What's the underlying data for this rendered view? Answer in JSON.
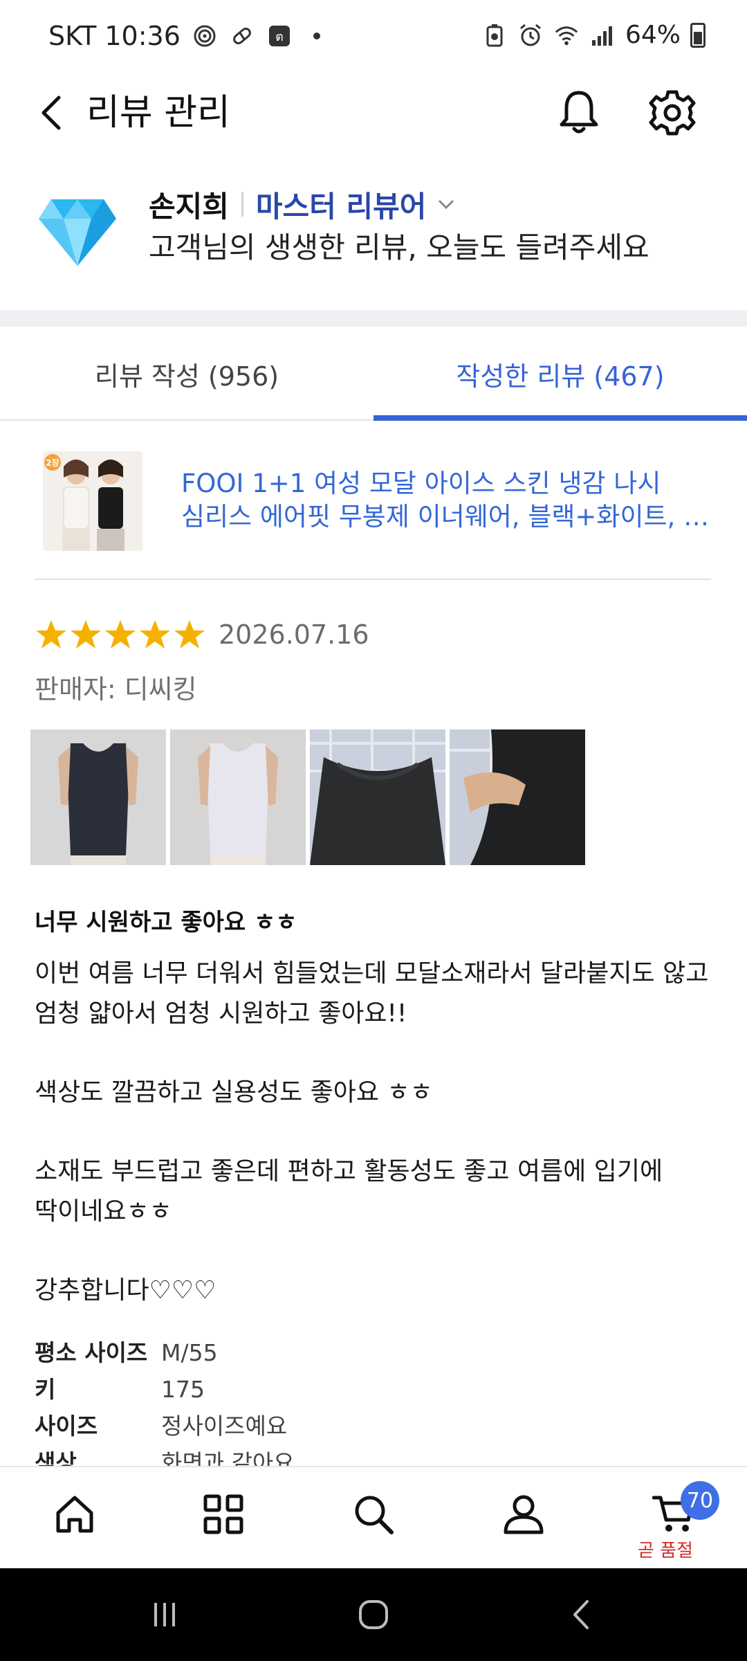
{
  "status_bar": {
    "carrier_time": "SKT 10:36",
    "battery": "64%"
  },
  "header": {
    "title": "리뷰 관리"
  },
  "profile": {
    "name": "손지희",
    "grade": "마스터 리뷰어",
    "subtitle": "고객님의 생생한 리뷰, 오늘도 들려주세요"
  },
  "tabs": [
    {
      "label": "리뷰 작성 (956)",
      "active": false
    },
    {
      "label": "작성한 리뷰 (467)",
      "active": true
    }
  ],
  "product": {
    "badge": "2장",
    "title_line1": "FOOI 1+1 여성 모달 아이스 스킨 냉감 나시",
    "title_line2": "심리스 에어핏 무봉제 이너웨어, 블랙+화이트, 3..."
  },
  "review": {
    "rating": 5,
    "date": "2026.07.16",
    "seller": "판매자: 디씨킹",
    "headline": "너무 시원하고 좋아요 ㅎㅎ",
    "body_p1_line1": "이번 여름 너무 더워서 힘들었는데 모달소재라서 달라붙지도 않고",
    "body_p1_line2": "엄청 얇아서 엄청 시원하고 좋아요!!",
    "body_p2": "색상도 깔끔하고 실용성도 좋아요 ㅎㅎ",
    "body_p3_line1": "소재도 부드럽고 좋은데 편하고 활동성도 좋고 여름에 입기에",
    "body_p3_line2": "딱이네요ㅎㅎ",
    "body_p4": "강추합니다♡♡♡",
    "specs": [
      {
        "key": "평소 사이즈",
        "value": "M/55"
      },
      {
        "key": "키",
        "value": "175"
      },
      {
        "key": "사이즈",
        "value": "정사이즈예요"
      },
      {
        "key": "색상",
        "value": "화면과 같아요"
      }
    ]
  },
  "bottom_nav": {
    "items": [
      "home-icon",
      "category-icon",
      "search-icon",
      "profile-icon",
      "cart-icon"
    ],
    "cart_count": "70",
    "cart_label": "곧 품절"
  },
  "colors": {
    "accent": "#3563d6",
    "grade": "#2a47a8",
    "star": "#f6b100",
    "link": "#3367d6",
    "badge": "#3f6fe6",
    "soldout": "#d12b2b"
  }
}
